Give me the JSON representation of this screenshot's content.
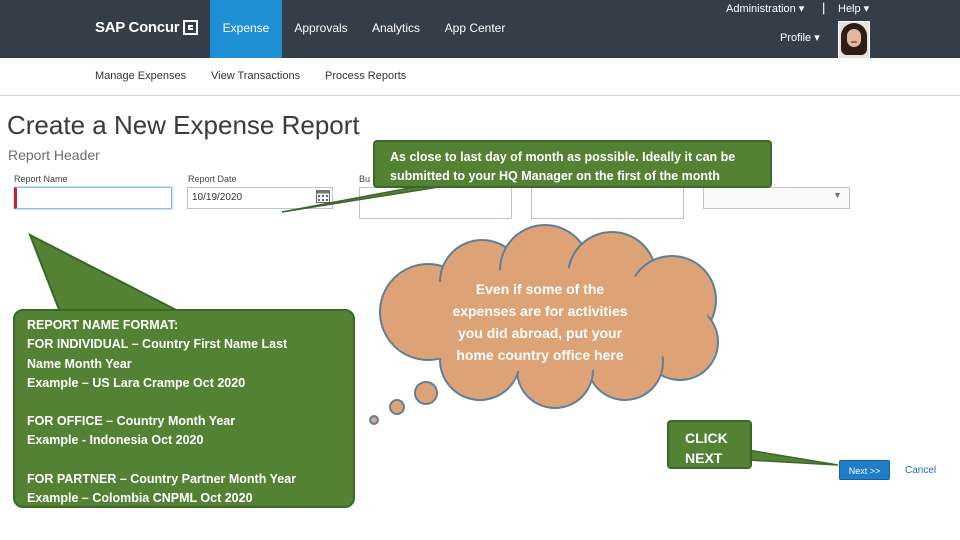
{
  "header": {
    "logo_text": "SAP Concur",
    "tabs": [
      {
        "label": "Expense",
        "active": true
      },
      {
        "label": "Approvals",
        "active": false
      },
      {
        "label": "Analytics",
        "active": false
      },
      {
        "label": "App Center",
        "active": false
      }
    ],
    "administration_label": "Administration ▾",
    "divider": "|",
    "help_label": "Help ▾",
    "profile_label": "Profile ▾"
  },
  "subnav": {
    "items": [
      "Manage Expenses",
      "View Transactions",
      "Process Reports"
    ]
  },
  "page": {
    "title": "Create a New Expense Report",
    "section_title": "Report Header"
  },
  "form": {
    "report_name_label": "Report Name",
    "report_name_value": "",
    "report_date_label": "Report Date",
    "report_date_value": "10/19/2020",
    "business_label": "Bu"
  },
  "callouts": {
    "date_tip": [
      "As close to last day of month as possible. Ideally it can be",
      "submitted to your HQ Manager on the first of the month"
    ],
    "name_format": {
      "heading": "REPORT NAME FORMAT:",
      "individual": [
        "FOR INDIVIDUAL – Country First Name Last",
        "Name Month Year",
        "Example – US Lara Crampe Oct 2020"
      ],
      "office": [
        "FOR OFFICE – Country Month Year",
        "Example - Indonesia Oct 2020"
      ],
      "partner": [
        "FOR PARTNER – Country Partner  Month Year",
        "Example – Colombia CNPML Oct 2020"
      ]
    },
    "cloud_lines": [
      "Even if some of the",
      "expenses are for activities",
      "you did abroad, put your",
      "home country office here"
    ],
    "click_next": [
      "CLICK",
      "NEXT"
    ]
  },
  "buttons": {
    "next_label": "Next >>",
    "cancel_label": "Cancel"
  },
  "colors": {
    "topbar": "#353d48",
    "active_tab": "#1e8fd4",
    "callout_green": "#548235",
    "cloud_fill": "#dda377",
    "cloud_stroke": "#5d7f9a",
    "next_button": "#1e7fc8"
  }
}
